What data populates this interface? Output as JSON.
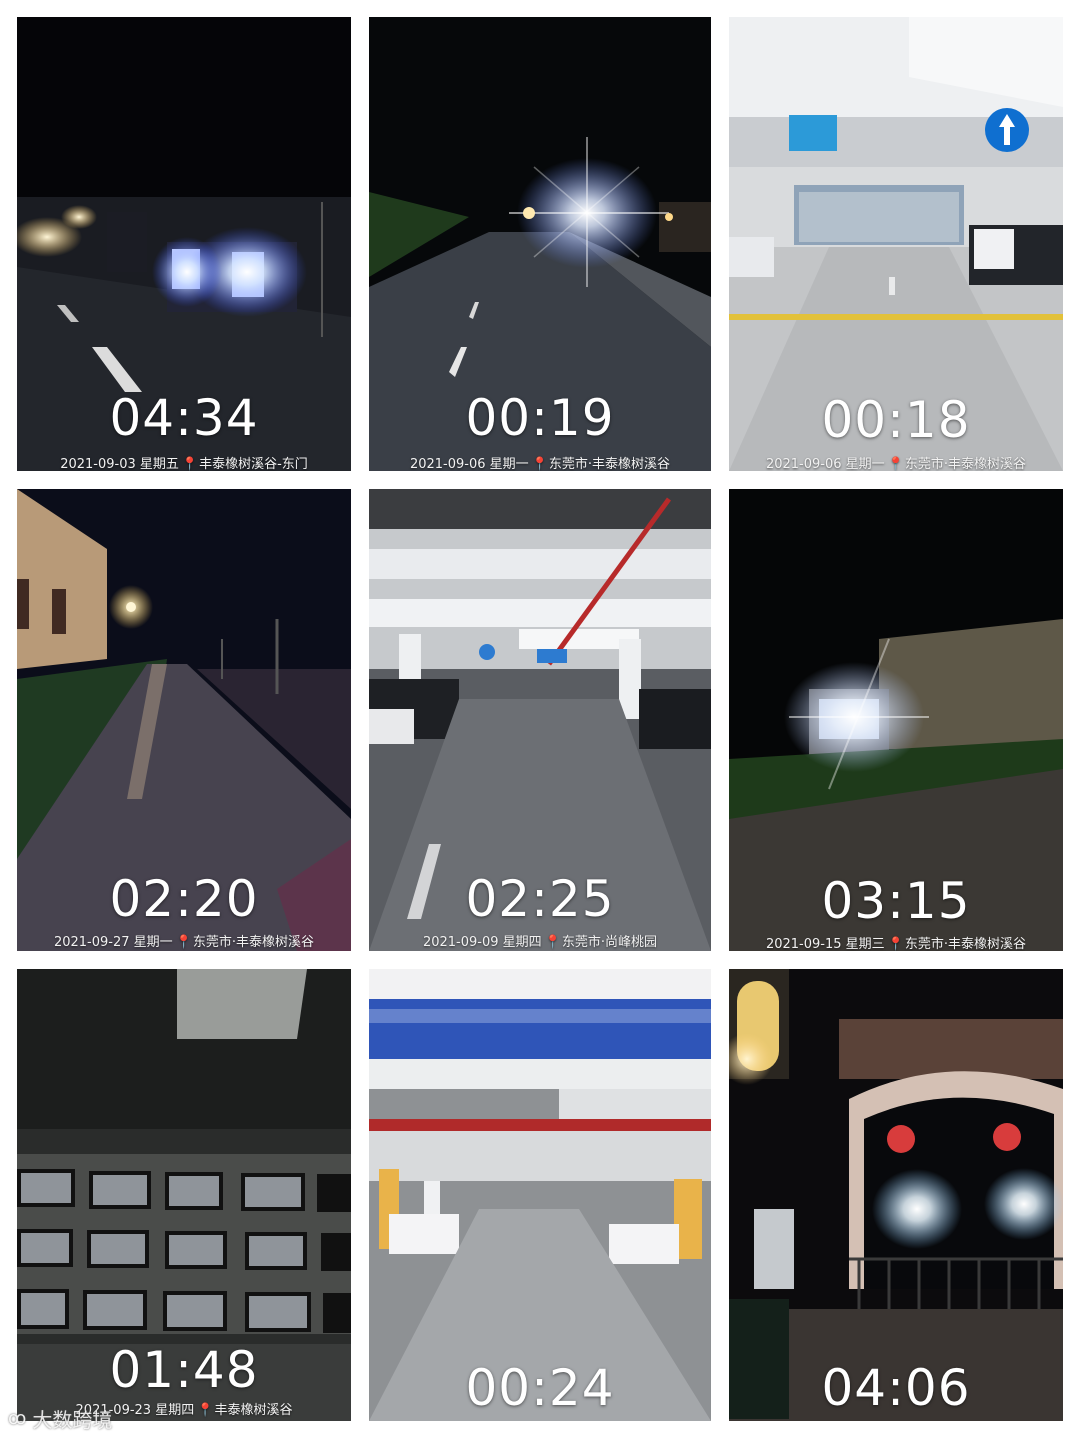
{
  "photos": [
    {
      "time": "04:34",
      "date": "2021-09-03",
      "weekday": "星期五",
      "location": "丰泰橡树溪谷-东门"
    },
    {
      "time": "00:19",
      "date": "2021-09-06",
      "weekday": "星期一",
      "location": "东莞市·丰泰橡树溪谷"
    },
    {
      "time": "00:18",
      "date": "2021-09-06",
      "weekday": "星期一",
      "location": "东莞市·丰泰橡树溪谷"
    },
    {
      "time": "02:20",
      "date": "2021-09-27",
      "weekday": "星期一",
      "location": "东莞市·丰泰橡树溪谷"
    },
    {
      "time": "02:25",
      "date": "2021-09-09",
      "weekday": "星期四",
      "location": "东莞市·尚峰桃园"
    },
    {
      "time": "03:15",
      "date": "2021-09-15",
      "weekday": "星期三",
      "location": "东莞市·丰泰橡树溪谷"
    },
    {
      "time": "01:48",
      "date": "2021-09-23",
      "weekday": "星期四",
      "location": "丰泰橡树溪谷"
    },
    {
      "time": "00:24",
      "date": "",
      "weekday": "",
      "location": ""
    },
    {
      "time": "04:06",
      "date": "",
      "weekday": "",
      "location": ""
    }
  ],
  "watermark": {
    "logo": "ꝏ",
    "text": "大数跨境"
  },
  "colors": {
    "background": "#ffffff",
    "pin": "#e0302c"
  }
}
